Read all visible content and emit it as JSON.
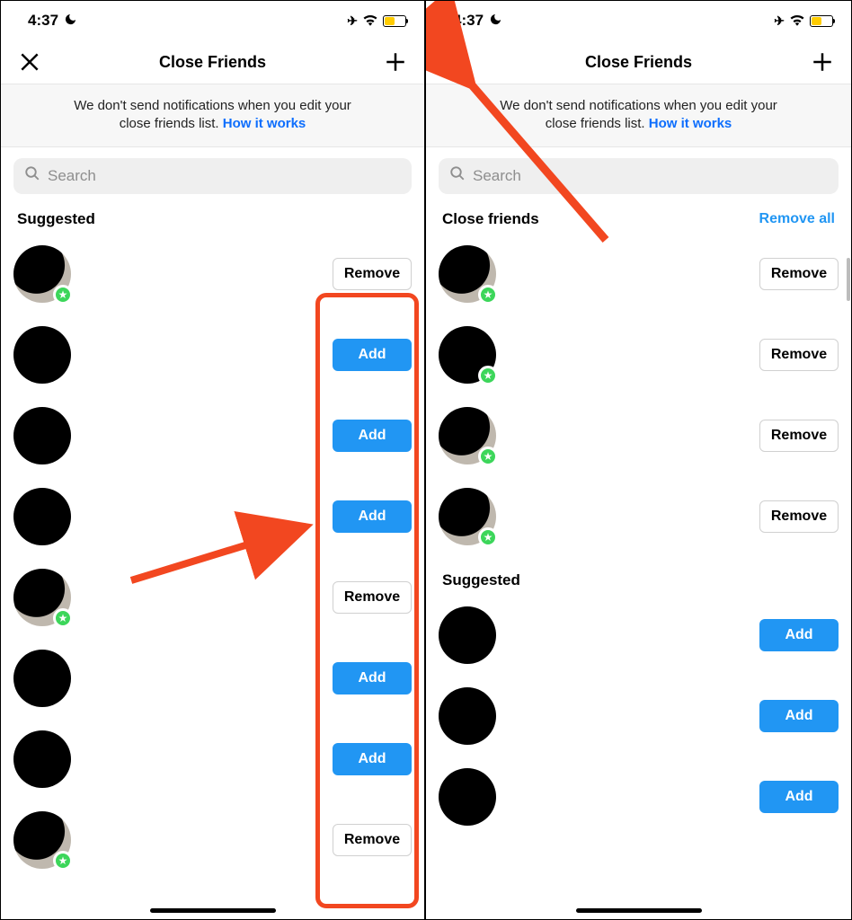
{
  "status": {
    "time": "4:37",
    "moon": "☾",
    "plane": "✈",
    "wifi": "wifi"
  },
  "header": {
    "title": "Close Friends"
  },
  "banner": {
    "text_a": "We don't send notifications when you edit your",
    "text_b": "close friends list.",
    "link": "How it works"
  },
  "search": {
    "placeholder": "Search"
  },
  "labels": {
    "suggested": "Suggested",
    "close_friends": "Close friends",
    "remove_all": "Remove all",
    "add": "Add",
    "remove": "Remove"
  },
  "left": {
    "rows": [
      {
        "action": "remove",
        "badge": true,
        "light": true
      },
      {
        "action": "add",
        "badge": false,
        "light": false
      },
      {
        "action": "add",
        "badge": false,
        "light": false
      },
      {
        "action": "add",
        "badge": false,
        "light": false
      },
      {
        "action": "remove",
        "badge": true,
        "light": true
      },
      {
        "action": "add",
        "badge": false,
        "light": false
      },
      {
        "action": "add",
        "badge": false,
        "light": false
      },
      {
        "action": "remove",
        "badge": true,
        "light": true
      }
    ]
  },
  "right": {
    "close": [
      {
        "badge": true,
        "light": true
      },
      {
        "badge": true,
        "light": false
      },
      {
        "badge": true,
        "light": true
      },
      {
        "badge": true,
        "light": true
      }
    ],
    "suggested": [
      {
        "badge": false
      },
      {
        "badge": false
      },
      {
        "badge": false
      }
    ]
  }
}
